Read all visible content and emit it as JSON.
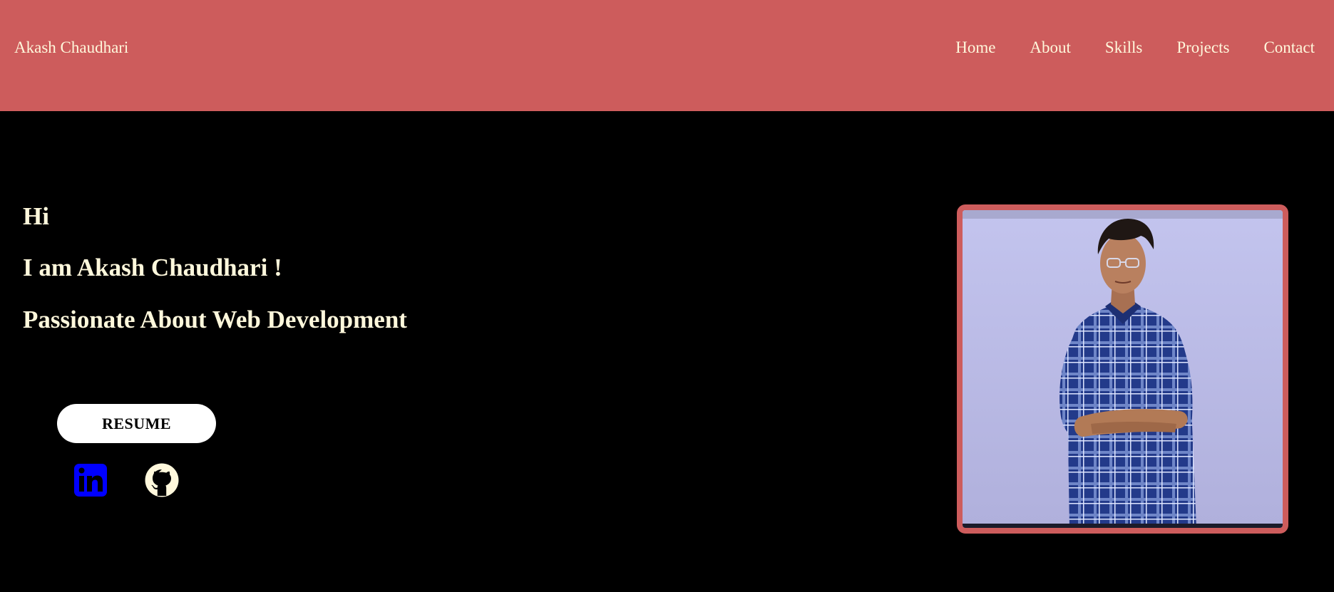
{
  "navbar": {
    "brand": "Akash Chaudhari",
    "links": [
      "Home",
      "About",
      "Skills",
      "Projects",
      "Contact"
    ]
  },
  "hero": {
    "greeting": "Hi",
    "intro": "I am Akash Chaudhari !",
    "tagline": "Passionate About Web Development",
    "resume_label": "RESUME",
    "social_icons": [
      "linkedin-icon",
      "github-icon"
    ]
  },
  "colors": {
    "accent": "#cd5c5c",
    "text": "#fff8dc",
    "background": "#000000",
    "linkedin": "#0000ff"
  }
}
